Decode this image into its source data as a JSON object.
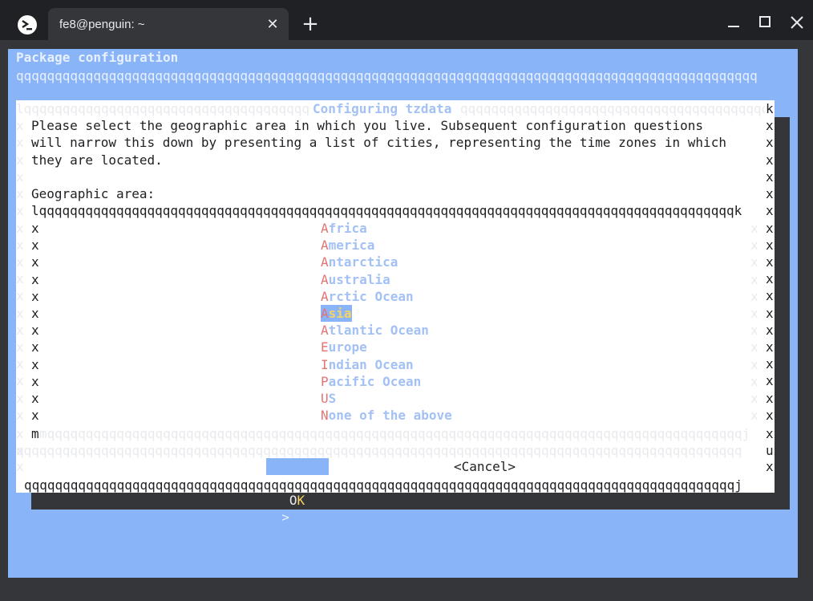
{
  "window": {
    "tab_title": "fe8@penguin: ~",
    "tab_close_glyph": "✕",
    "new_tab_glyph": "+"
  },
  "terminal": {
    "package_title": "Package configuration",
    "package_rule": "qqqqqqqqqqqqqqqqqqqqqqqqqqqqqqqqqqqqqqqqqqqqqqqqqqqqqqqqqqqqqqqqqqqqqqqqqqqqqqqqqqqqqqqqqqqqqqqq",
    "dialog": {
      "top_left_rule": "lqqqqqqqqqqqqqqqqqqqqqqqqqqqqqqqqqqqqq",
      "title": "Configuring tzdata",
      "top_right_rule": "qqqqqqqqqqqqqqqqqqqqqqqqqqqqqqqqqqqqqqqq",
      "top_right_corner": "k",
      "description_lines": [
        "Please select the geographic area in which you live. Subsequent configuration questions",
        "will narrow this down by presenting a list of cities, representing the time zones in which",
        "they are located."
      ],
      "prompt": "Geographic area:",
      "list_top_rule": "lqqqqqqqqqqqqqqqqqqqqqqqqqqqqqqqqqqqqqqqqqqqqqqqqqqqqqqqqqqqqqqqqqqqqqqqqqqqqqqqqqqqqqqqqqqk",
      "list_bottom_rule": "mqqqqqqqqqqqqqqqqqqqqqqqqqqqqqqqqqqqqqqqqqqqqqqqqqqqqqqqqqqqqqqqqqqqqqqqqqqqqqqqqqqqqqqqqqqj",
      "after_list_rule": "qqqqqqqqqqqqqqqqqqqqqqqqqqqqqqqqqqqqqqqqqqqqqqqqqqqqqqqqqqqqqqqqqqqqqqqqqqqqqqqqqqqqqqqqqqqqqq",
      "bottom_rule": "qqqqqqqqqqqqqqqqqqqqqqqqqqqqqqqqqqqqqqqqqqqqqqqqqqqqqqqqqqqqqqqqqqqqqqqqqqqqqqqqqqqqqqqqqqqqj",
      "border_char": "x",
      "right_u": "u",
      "areas": [
        {
          "hot": "A",
          "rest": "frica"
        },
        {
          "hot": "A",
          "rest": "merica"
        },
        {
          "hot": "A",
          "rest": "ntarctica"
        },
        {
          "hot": "A",
          "rest": "ustralia"
        },
        {
          "hot": "A",
          "rest": "rctic Ocean"
        },
        {
          "hot": "A",
          "rest": "sia",
          "selected": true
        },
        {
          "hot": "A",
          "rest": "tlantic Ocean"
        },
        {
          "hot": "E",
          "rest": "urope"
        },
        {
          "hot": "I",
          "rest": "ndian Ocean"
        },
        {
          "hot": "P",
          "rest": "acific Ocean"
        },
        {
          "hot": "U",
          "rest": "S"
        },
        {
          "hot": "N",
          "rest": "one of the above"
        }
      ],
      "ok_button": {
        "left": "<",
        "o": " O",
        "k": "K",
        "right": ">"
      },
      "cancel_button": "<Cancel>"
    }
  }
}
